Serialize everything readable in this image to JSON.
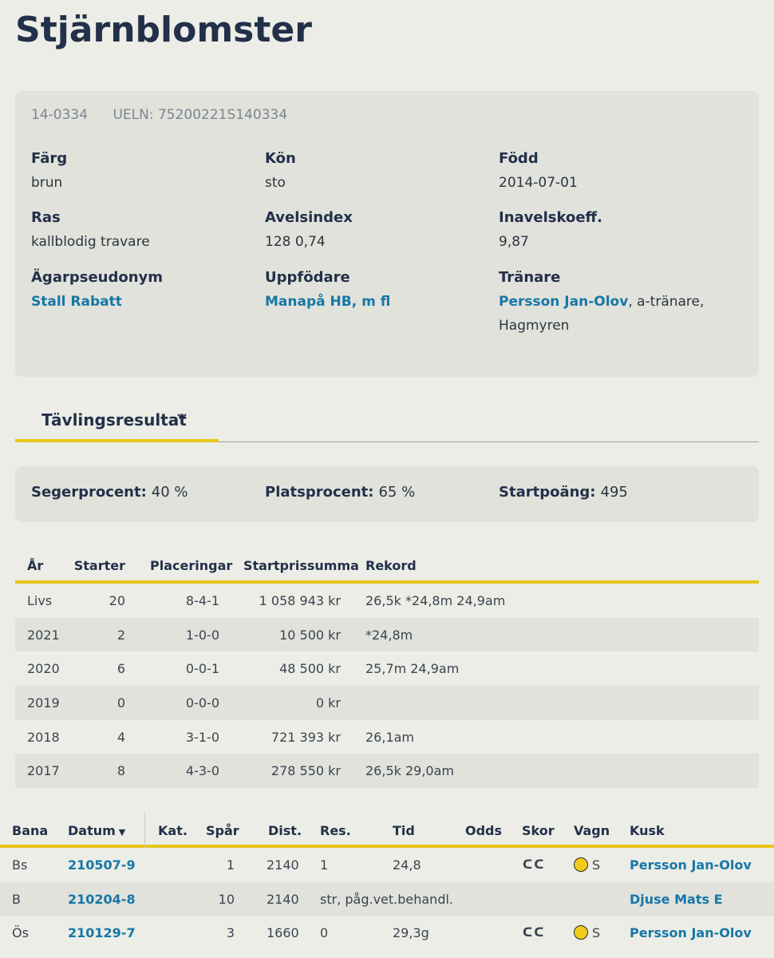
{
  "horse": {
    "name": "Stjärnblomster",
    "reg_no": "14-0334",
    "ueln": "UELN: 75200221S140334"
  },
  "info": {
    "farg": {
      "label": "Färg",
      "value": "brun"
    },
    "kon": {
      "label": "Kön",
      "value": "sto"
    },
    "fodd": {
      "label": "Född",
      "value": "2014-07-01"
    },
    "ras": {
      "label": "Ras",
      "value": "kallblodig travare"
    },
    "avelsindex": {
      "label": "Avelsindex",
      "value": "128 0,74"
    },
    "inavel": {
      "label": "Inavelskoeff.",
      "value": "9,87"
    },
    "agare": {
      "label": "Ägarpseudonym",
      "value": "Stall Rabatt"
    },
    "uppfodare": {
      "label": "Uppfödare",
      "value": "Manapå HB, m fl"
    },
    "tranare": {
      "label": "Tränare",
      "value": "Persson Jan-Olov",
      "suffix": ", a-tränare,",
      "suffix2": "Hagmyren"
    }
  },
  "tab": {
    "label": "Tävlingsresultat",
    "chevron": "chevron-down-icon"
  },
  "stats": {
    "seger": {
      "label": "Segerprocent:",
      "value": "40 %"
    },
    "plats": {
      "label": "Platsprocent:",
      "value": "65 %"
    },
    "poang": {
      "label": "Startpoäng:",
      "value": "495"
    }
  },
  "summary": {
    "headers": [
      "År",
      "Starter",
      "Placeringar",
      "Startprissumma",
      "Rekord"
    ],
    "rows": [
      [
        "Livs",
        "20",
        "8-4-1",
        "1 058 943 kr",
        "26,5k *24,8m 24,9am"
      ],
      [
        "2021",
        "2",
        "1-0-0",
        "10 500 kr",
        "*24,8m"
      ],
      [
        "2020",
        "6",
        "0-0-1",
        "48 500 kr",
        "25,7m 24,9am"
      ],
      [
        "2019",
        "0",
        "0-0-0",
        "0 kr",
        ""
      ],
      [
        "2018",
        "4",
        "3-1-0",
        "721 393 kr",
        "26,1am"
      ],
      [
        "2017",
        "8",
        "4-3-0",
        "278 550 kr",
        "26,5k 29,0am"
      ]
    ]
  },
  "runs": {
    "headers": {
      "bana": "Bana",
      "datum": "Datum",
      "kat": "Kat.",
      "spar": "Spår",
      "dist": "Dist.",
      "res": "Res.",
      "tid": "Tid",
      "odds": "Odds",
      "skor": "Skor",
      "vagn": "Vagn",
      "kusk": "Kusk"
    },
    "sort_icon": "caret-down-icon",
    "rows": [
      {
        "bana": "Bs",
        "datum": "210507-9",
        "kat": "",
        "spar": "1",
        "dist": "2140",
        "res": "1",
        "tid": "24,8",
        "odds": "",
        "skor": "ᑕᑕ",
        "vagn": "S",
        "vagn_icon": "yellow-ball-icon",
        "kusk": "Persson Jan-Olov"
      },
      {
        "bana": "B",
        "datum": "210204-8",
        "kat": "",
        "spar": "10",
        "dist": "2140",
        "res": "str, påg.vet.behandl.",
        "tid": "",
        "odds": "",
        "skor": "",
        "vagn": "",
        "vagn_icon": "",
        "kusk": "Djuse Mats E"
      },
      {
        "bana": "Ös",
        "datum": "210129-7",
        "kat": "",
        "spar": "3",
        "dist": "1660",
        "res": "0",
        "tid": "29,3g",
        "odds": "",
        "skor": "ᑕᑕ",
        "vagn": "S",
        "vagn_icon": "yellow-ball-icon",
        "kusk": "Persson Jan-Olov"
      }
    ]
  },
  "colors": {
    "accent": "#e6c619",
    "link": "#1677a7",
    "card": "#e1e2db",
    "background": "#ecede6"
  }
}
